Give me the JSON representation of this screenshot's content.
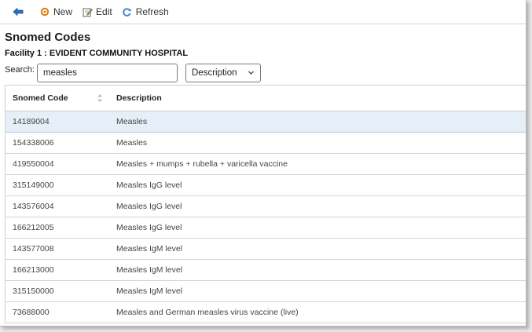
{
  "toolbar": {
    "new_label": "New",
    "edit_label": "Edit",
    "refresh_label": "Refresh"
  },
  "page": {
    "title": "Snomed Codes",
    "facility": "Facility 1 : EVIDENT COMMUNITY HOSPITAL"
  },
  "search": {
    "label": "Search:",
    "value": "measles",
    "field_selected": "Description"
  },
  "table": {
    "columns": [
      "Snomed Code",
      "Description"
    ],
    "rows": [
      {
        "code": "14189004",
        "description": "Measles",
        "selected": true
      },
      {
        "code": "154338006",
        "description": "Measles"
      },
      {
        "code": "419550004",
        "description": "Measles + mumps + rubella + varicella vaccine"
      },
      {
        "code": "315149000",
        "description": "Measles IgG level"
      },
      {
        "code": "143576004",
        "description": "Measles IgG level"
      },
      {
        "code": "166212005",
        "description": "Measles IgG level"
      },
      {
        "code": "143577008",
        "description": "Measles IgM level"
      },
      {
        "code": "166213000",
        "description": "Measles IgM level"
      },
      {
        "code": "315150000",
        "description": "Measles IgM level"
      },
      {
        "code": "73688000",
        "description": "Measles and German measles virus vaccine (live)"
      }
    ]
  },
  "colors": {
    "selected_row": "#e6eef8",
    "back_arrow": "#2f6fc6",
    "new_icon": "#e07a10"
  }
}
